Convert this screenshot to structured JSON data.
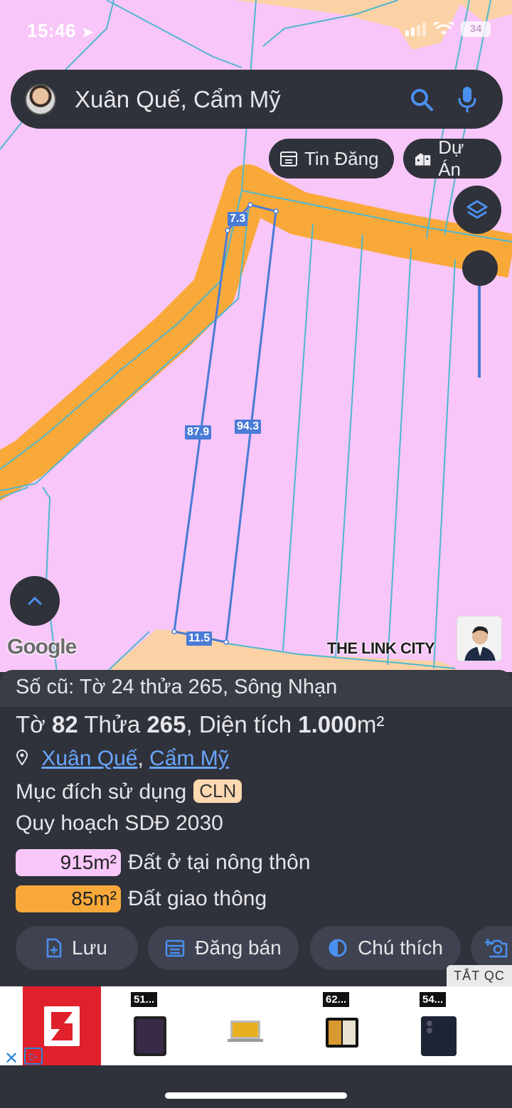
{
  "status": {
    "time": "15:46",
    "battery": "34"
  },
  "search": {
    "text": "Xuân Quế, Cẩm Mỹ"
  },
  "chips": {
    "tin_dang": "Tin Đăng",
    "du_an": "Dự Án"
  },
  "map": {
    "measurements": {
      "top": "7.3",
      "left": "87.9",
      "right": "94.3",
      "bottom": "11.5"
    },
    "google": "Google",
    "brand": "THE LINK CITY"
  },
  "panel": {
    "old_ref": "Số cũ: Tờ 24 thửa 265, Sông Nhạn",
    "parcel": {
      "to_label": "Tờ",
      "to_value": "82",
      "thua_label": "Thửa",
      "thua_value": "265",
      "area_label": ", Diện tích",
      "area_value": "1.000",
      "area_unit": "m²"
    },
    "location": {
      "commune": "Xuân Quế",
      "district": "Cẩm Mỹ",
      "sep": ", "
    },
    "purpose_label": "Mục đích sử dụng",
    "purpose_code": "CLN",
    "plan_label": "Quy hoạch SDĐ 2030",
    "zones": [
      {
        "area": "915m²",
        "label": "Đất ở tại nông thôn",
        "color": "#f8c6f8"
      },
      {
        "area": "85m²",
        "label": "Đất giao thông",
        "color": "#f9a93a"
      }
    ]
  },
  "actions": {
    "save": "Lưu",
    "post": "Đăng bán",
    "legend": "Chú thích"
  },
  "ad": {
    "hide_label": "TẮT QC",
    "prices": [
      "51...",
      "62...",
      "54..."
    ]
  }
}
